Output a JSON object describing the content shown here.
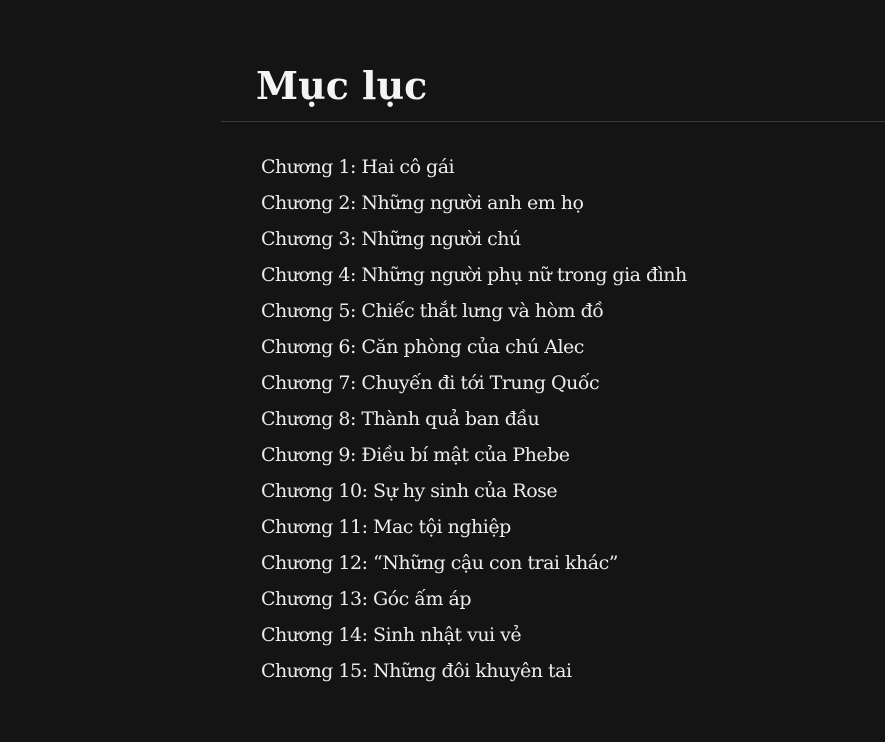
{
  "toc": {
    "heading": "Mục lục",
    "chapters": [
      {
        "label": "Chương 1: Hai cô gái"
      },
      {
        "label": "Chương 2: Những người anh em họ"
      },
      {
        "label": "Chương 3: Những người chú"
      },
      {
        "label": "Chương 4: Những người phụ nữ trong gia đình"
      },
      {
        "label": "Chương 5: Chiếc thắt lưng và hòm đồ"
      },
      {
        "label": "Chương 6: Căn phòng của chú Alec"
      },
      {
        "label": "Chương 7: Chuyến đi tới Trung Quốc"
      },
      {
        "label": "Chương 8: Thành quả ban đầu"
      },
      {
        "label": "Chương 9: Điều bí mật của Phebe"
      },
      {
        "label": "Chương 10: Sự hy sinh của Rose"
      },
      {
        "label": "Chương 11: Mac tội nghiệp"
      },
      {
        "label": "Chương 12: “Những cậu con trai khác”"
      },
      {
        "label": "Chương 13: Góc ấm áp"
      },
      {
        "label": "Chương 14: Sinh nhật vui vẻ"
      },
      {
        "label": "Chương 15: Những đôi khuyên tai"
      }
    ]
  }
}
